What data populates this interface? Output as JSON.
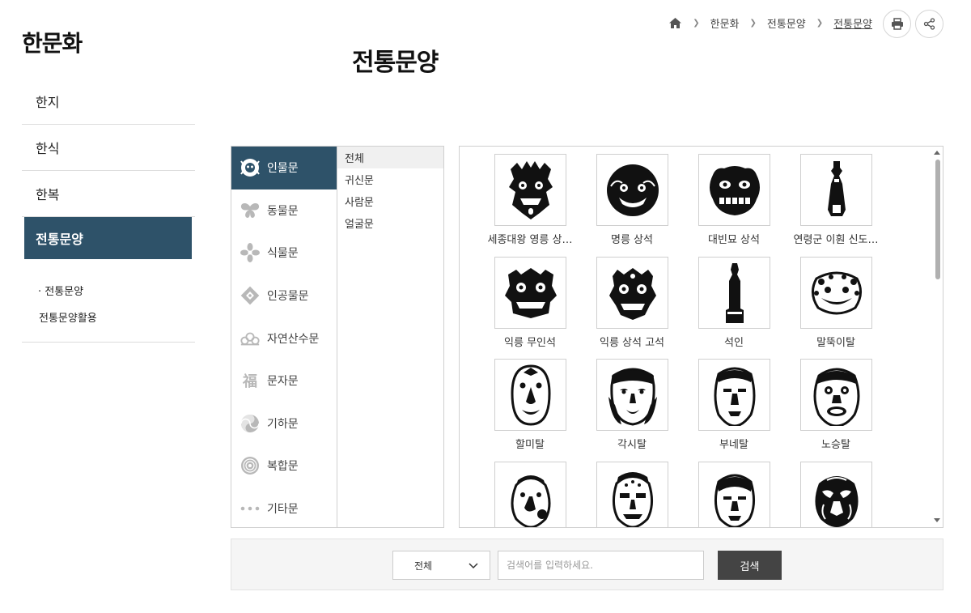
{
  "sidebar": {
    "brand": "한문화",
    "items": [
      {
        "label": "한지"
      },
      {
        "label": "한식"
      },
      {
        "label": "한복"
      },
      {
        "label": "전통문양"
      }
    ],
    "sub_items": [
      {
        "label": "· 전통문양"
      },
      {
        "label": "전통문양활용"
      }
    ]
  },
  "breadcrumb": [
    "한문화",
    "전통문양",
    "전통문양"
  ],
  "page_title": "전통문양",
  "categories": [
    {
      "label": "인물문",
      "icon": "face-pattern-icon"
    },
    {
      "label": "동물문",
      "icon": "butterfly-icon"
    },
    {
      "label": "식물문",
      "icon": "flower-icon"
    },
    {
      "label": "인공물문",
      "icon": "diamond-pattern-icon"
    },
    {
      "label": "자연산수문",
      "icon": "cloud-icon"
    },
    {
      "label": "문자문",
      "icon": "character-icon"
    },
    {
      "label": "기하문",
      "icon": "swirl-icon"
    },
    {
      "label": "복합문",
      "icon": "circle-pattern-icon"
    },
    {
      "label": "기타문",
      "icon": "dots-icon"
    }
  ],
  "category_char": "福",
  "subcategories": [
    "전체",
    "귀신문",
    "사람문",
    "얼굴문"
  ],
  "thumbnails": [
    {
      "label": "세종대왕 영릉 상…"
    },
    {
      "label": "명릉 상석"
    },
    {
      "label": "대빈묘 상석"
    },
    {
      "label": "연령군 이훤 신도…"
    },
    {
      "label": "익릉 무인석"
    },
    {
      "label": "익릉 상석 고석"
    },
    {
      "label": "석인"
    },
    {
      "label": "말뚝이탈"
    },
    {
      "label": "할미탈"
    },
    {
      "label": "각시탈"
    },
    {
      "label": "부네탈"
    },
    {
      "label": "노승탈"
    },
    {
      "label": ""
    },
    {
      "label": ""
    },
    {
      "label": ""
    },
    {
      "label": ""
    }
  ],
  "search": {
    "select_value": "전체",
    "placeholder": "검색어를 입력하세요.",
    "button_label": "검색"
  },
  "colors": {
    "accent": "#2e5269",
    "button": "#444444"
  }
}
